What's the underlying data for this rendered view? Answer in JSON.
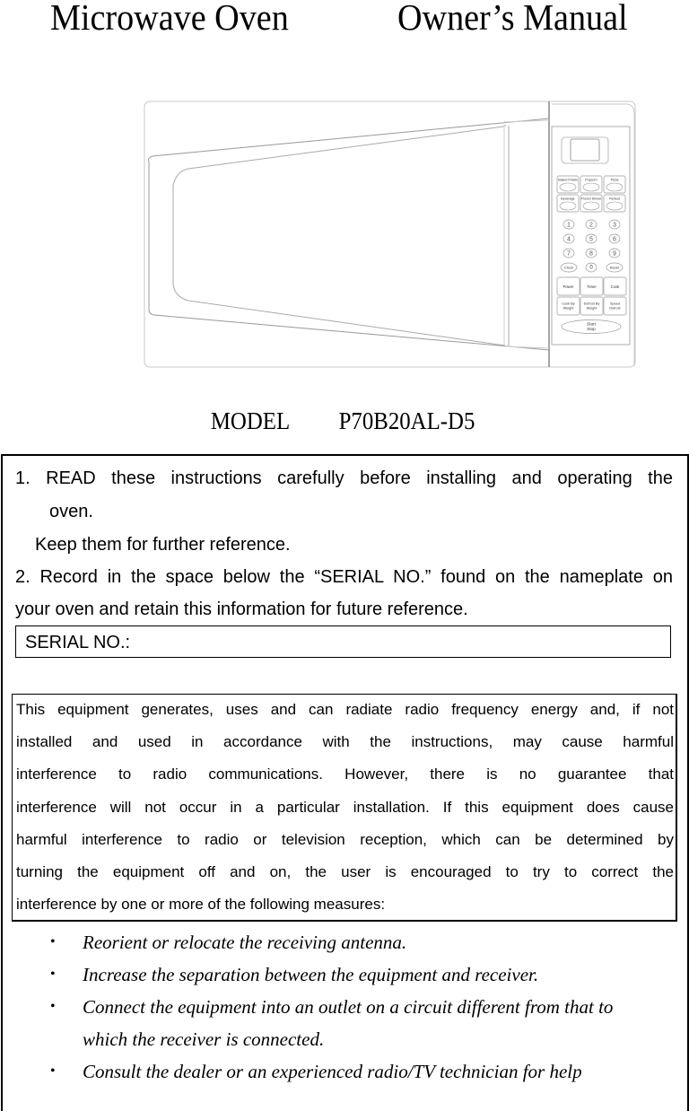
{
  "header": {
    "title_left": "Microwave Oven",
    "title_right": "Owner’s Manual"
  },
  "illustration": {
    "icon": "microwave-oven-drawing",
    "control_panel": {
      "display": "",
      "auto_buttons": [
        "Baked Potato",
        "Popcorn",
        "Pizza",
        "Beverage",
        "Frozen Dinner",
        "Reheat"
      ],
      "number_keys": [
        "1",
        "2",
        "3",
        "4",
        "5",
        "6",
        "7",
        "8",
        "9"
      ],
      "bottom_keys": [
        "Clock",
        "0",
        "Reset"
      ],
      "function_buttons": [
        "Power",
        "Timer",
        "Cook"
      ],
      "weight_buttons": [
        {
          "line1": "Cook By",
          "line2": "Weight"
        },
        {
          "line1": "Defrost By",
          "line2": "Weight"
        },
        {
          "line1": "Speed",
          "line2": "Defrost"
        }
      ],
      "start_button": {
        "line1": "Start",
        "line2": "Stop"
      }
    }
  },
  "model": {
    "label": "MODEL",
    "number": "P70B20AL-D5"
  },
  "instructions": {
    "item1_line1": "1.   READ  these  instructions  carefully  before  installing  and  operating  the",
    "item1_line2": "oven.",
    "item1_line3": "Keep them for further reference.",
    "item2_line1": "2. Record in the space below the “SERIAL NO.” found on the nameplate on",
    "item2_line2": "your oven and retain this information for future reference.",
    "serial_label": "SERIAL NO.:",
    "serial_value": ""
  },
  "fcc_notice": {
    "lines": [
      "This equipment generates, uses and can radiate radio frequency energy and, if not",
      "installed and used in accordance with the instructions, may cause harmful",
      "interference to radio communications. However, there is no guarantee that",
      "interference will not occur in a particular installation. If this equipment does cause",
      "harmful interference to radio or television reception, which can be determined by",
      "turning the equipment off and on, the user is encouraged to try to correct the",
      "interference by one or more of the following measures:"
    ]
  },
  "measures": {
    "bullet": "•",
    "items": [
      "Reorient or relocate the receiving antenna.",
      "Increase the separation between the equipment and receiver.",
      "Connect the equipment into an outlet on a circuit different from that to",
      "which the receiver is connected.",
      "Consult the dealer or an experienced radio/TV technician for help"
    ]
  }
}
